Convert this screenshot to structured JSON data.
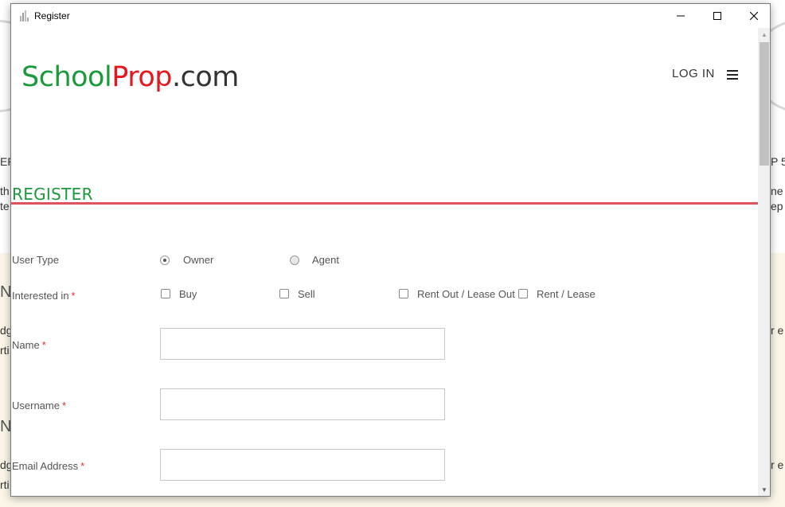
{
  "window": {
    "title": "Register",
    "minimize_glyph": "—",
    "maximize_glyph": "☐",
    "close_glyph": "✕"
  },
  "header": {
    "logo_part1": "School",
    "logo_part2": "Prop",
    "logo_part3": ".com",
    "login_label": "LOG IN",
    "menu_icon": "hamburger-icon"
  },
  "page": {
    "heading": "REGISTER"
  },
  "form": {
    "user_type": {
      "label": "User Type",
      "options": [
        {
          "label": "Owner",
          "checked": true
        },
        {
          "label": "Agent",
          "checked": false
        }
      ]
    },
    "interested_in": {
      "label": "Interested in",
      "required_mark": "*",
      "options": [
        {
          "label": "Buy"
        },
        {
          "label": "Sell"
        },
        {
          "label": "Rent Out / Lease Out"
        },
        {
          "label": "Rent / Lease"
        }
      ]
    },
    "name": {
      "label": "Name",
      "required_mark": "*",
      "value": ""
    },
    "username": {
      "label": "Username",
      "required_mark": "*",
      "value": ""
    },
    "email": {
      "label": "Email Address",
      "required_mark": "*",
      "value": ""
    }
  },
  "background": {
    "fragments_left": [
      "EP",
      "th",
      "te",
      "NE",
      "dg",
      "rti",
      "NE",
      "dg",
      "rti"
    ],
    "fragments_right": [
      "P 5",
      "ne t",
      "ep",
      "r e",
      "r e"
    ]
  },
  "colors": {
    "brand_green": "#1a9a3a",
    "brand_red": "#e8171e",
    "divider_red": "#e0535a",
    "required_red": "#e03030"
  }
}
